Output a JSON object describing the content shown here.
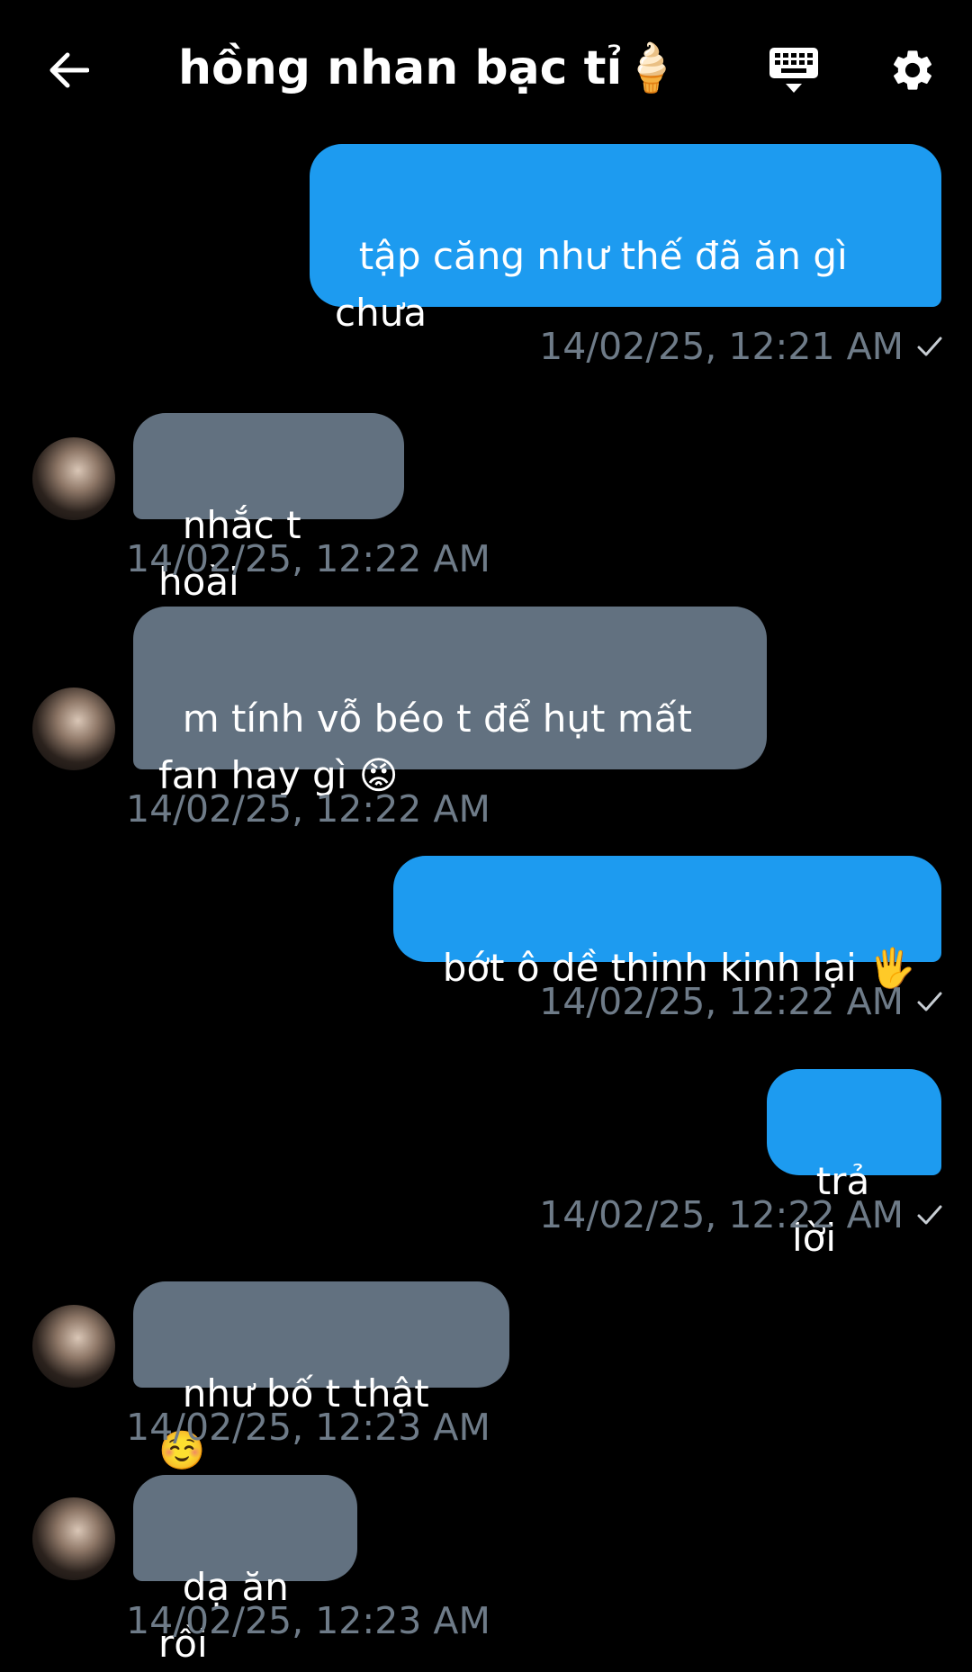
{
  "header": {
    "title": "hồng nhan bạc tỉ🍦",
    "back_icon": "arrow-left-icon",
    "keyboard_icon": "keyboard-icon",
    "settings_icon": "gear-icon"
  },
  "messages": [
    {
      "direction": "sent",
      "text": "tập căng như thế đã ăn gì chưa",
      "timestamp": "14/02/25, 12:21 AM",
      "read": true
    },
    {
      "direction": "received",
      "text": "nhắc t hoài",
      "timestamp": "14/02/25, 12:22 AM"
    },
    {
      "direction": "received",
      "text": "m tính vỗ béo t để hụt mất fan hay gì 😡",
      "timestamp": "14/02/25, 12:22 AM"
    },
    {
      "direction": "sent",
      "text": "bớt ô dề thinh kinh lại 🖐️",
      "timestamp": "14/02/25, 12:22 AM",
      "read": true
    },
    {
      "direction": "sent",
      "text": "trả lời",
      "timestamp": "14/02/25, 12:22 AM",
      "read": true
    },
    {
      "direction": "received",
      "text": "như bố t thật ☺️",
      "timestamp": "14/02/25, 12:23 AM"
    },
    {
      "direction": "received",
      "text": "dạ ăn rồi",
      "timestamp": "14/02/25, 12:23 AM"
    }
  ],
  "colors": {
    "background": "#000000",
    "sent_bubble": "#1d9bf0",
    "received_bubble": "#627180",
    "timestamp": "#6e7b88"
  }
}
